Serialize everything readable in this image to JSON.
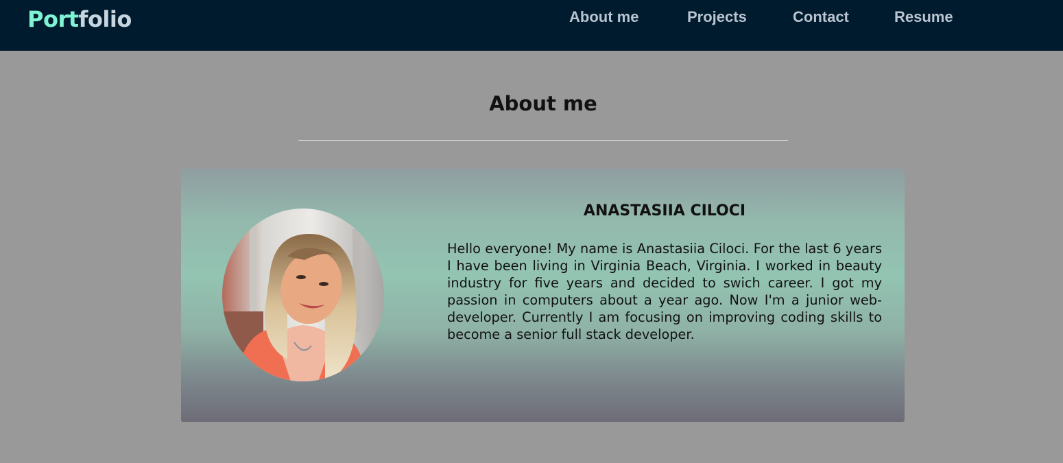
{
  "header": {
    "logo_part1": "Port",
    "logo_part2": "folio",
    "nav": [
      "About me",
      "Projects",
      "Contact",
      "Resume"
    ]
  },
  "about": {
    "title": "About me",
    "name": "ANASTASIIA CILOCI",
    "bio": "Hello everyone! My name is Anastasiia Ciloci. For the last 6 years I have been living in Virginia Beach, Virginia. I worked in beauty industry for five years and decided to swich career. I got my passion in computers about a year ago. Now I'm a junior web-developer. Currently I am focusing on improving coding skills to become a senior full stack developer."
  },
  "colors": {
    "header_bg": "#001b2e",
    "logo_accent": "#7ff3d3",
    "page_bg": "#999999"
  }
}
